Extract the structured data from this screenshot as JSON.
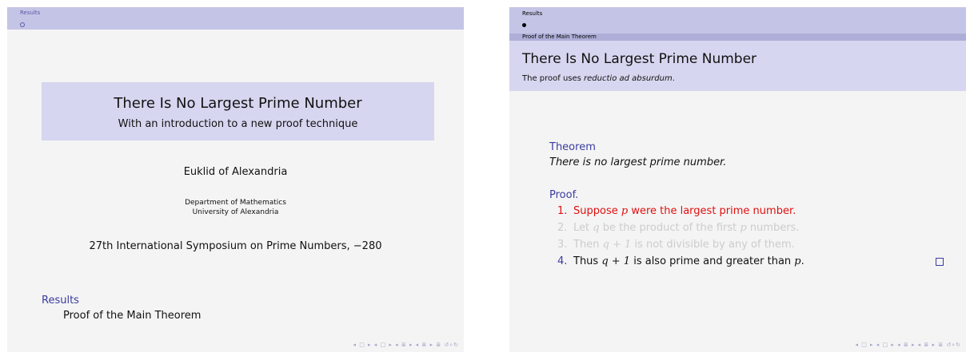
{
  "slide1": {
    "headline": {
      "section": "Results"
    },
    "title": "There Is No Largest Prime Number",
    "subtitle": "With an introduction to a new proof technique",
    "author": "Euklid of Alexandria",
    "institute_line1": "Department of Mathematics",
    "institute_line2": "University of Alexandria",
    "event": "27th International Symposium on Prime Numbers, −280",
    "toc": {
      "section": "Results",
      "subsection": "Proof of the Main Theorem"
    },
    "nav_symbols": "◂ □ ▸ ◂ □ ▸ ◂ ≣ ▸ ◂ ≣ ▸  ≣  ↺⌕↻"
  },
  "slide2": {
    "headline": {
      "section": "Results",
      "subsection": "Proof of the Main Theorem"
    },
    "frametitle": "There Is No Largest Prime Number",
    "framesubtitle": {
      "prefix": "The proof uses ",
      "emph": "reductio ad absurdum",
      "suffix": "."
    },
    "theorem": {
      "title": "Theorem",
      "body": "There is no largest prime number."
    },
    "proof": {
      "title": "Proof.",
      "items": [
        {
          "num": "1.",
          "parts": [
            "Suppose ",
            "p",
            " were the largest prime number."
          ]
        },
        {
          "num": "2.",
          "parts": [
            "Let ",
            "q",
            " be the product of the first ",
            "p",
            " numbers."
          ]
        },
        {
          "num": "3.",
          "parts": [
            "Then ",
            "q + 1",
            " is not divisible by any of them."
          ]
        },
        {
          "num": "4.",
          "parts": [
            "Thus ",
            "q + 1",
            " is also prime and greater than ",
            "p",
            "."
          ]
        }
      ]
    },
    "nav_symbols": "◂ □ ▸ ◂ □ ▸ ◂ ≣ ▸ ◂ ≣ ▸  ≣  ↺⌕↻"
  },
  "colors": {
    "header": "#c4c4e6",
    "block_title": "#3b3ba0",
    "alert": "#e01010",
    "inactive": "#cccccc"
  }
}
